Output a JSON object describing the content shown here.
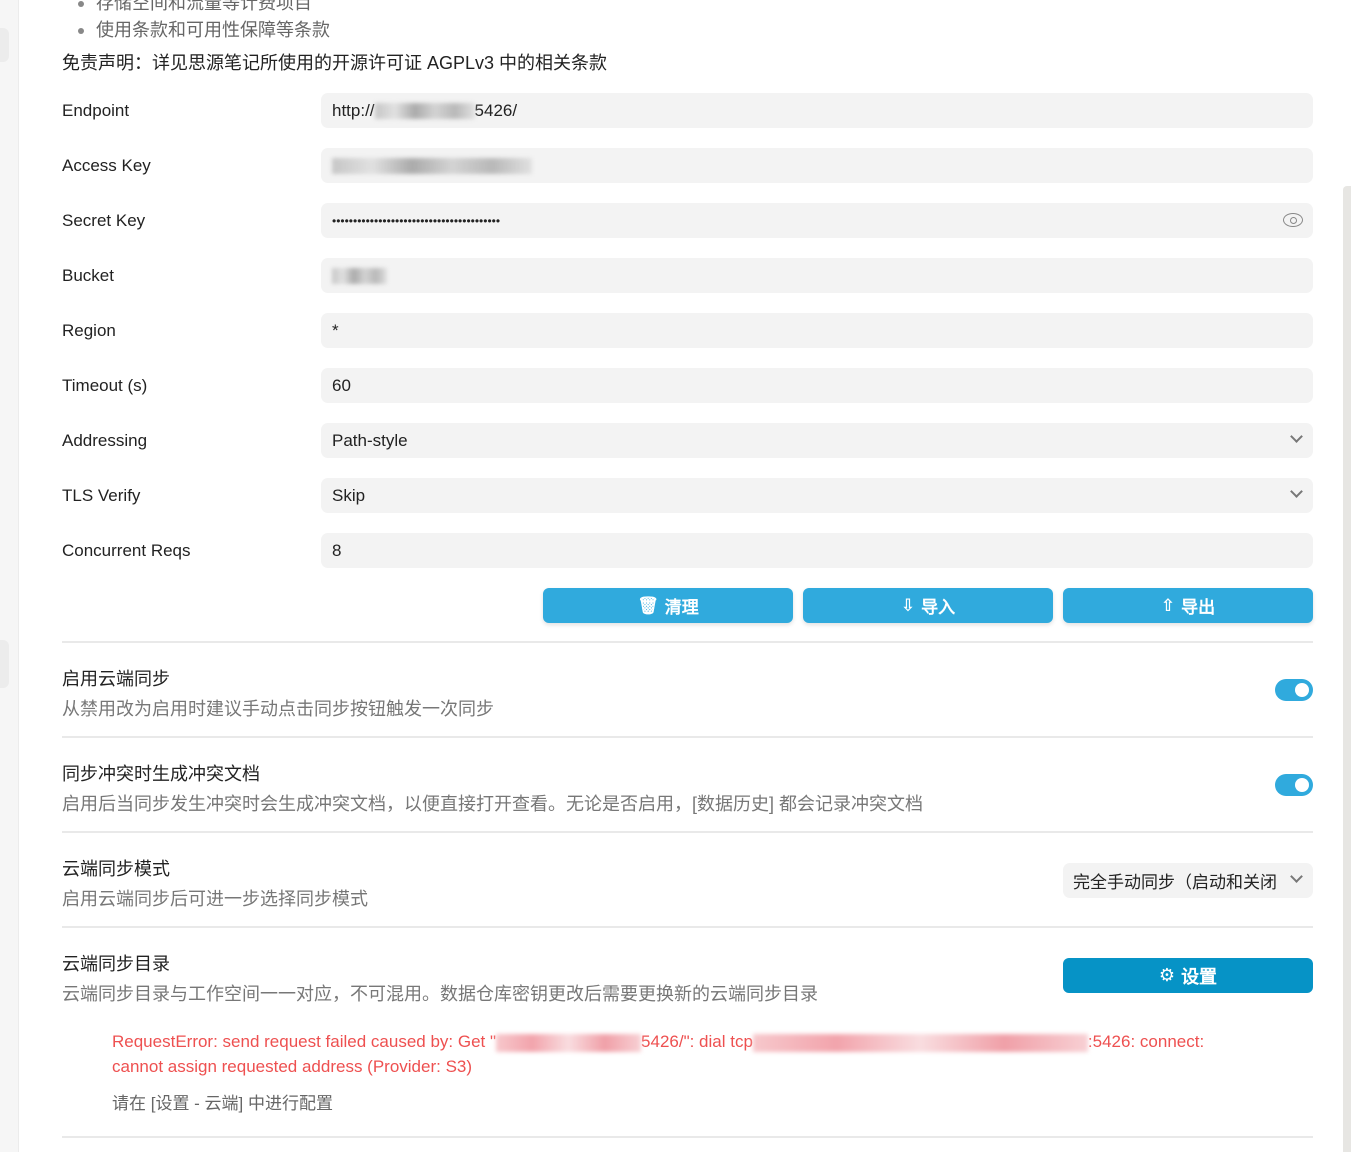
{
  "intro": {
    "bullets": [
      "存储空间和流量等计费项目",
      "使用条款和可用性保障等条款"
    ],
    "disclaimer": "免责声明：详见思源笔记所使用的开源许可证 AGPLv3 中的相关条款"
  },
  "form": {
    "endpoint": {
      "label": "Endpoint",
      "prefix": "http://",
      "suffix": "5426/"
    },
    "access_key": {
      "label": "Access Key"
    },
    "secret_key": {
      "label": "Secret Key",
      "value": "••••••••••••••••••••••••••••••••••••••••"
    },
    "bucket": {
      "label": "Bucket"
    },
    "region": {
      "label": "Region",
      "value": "*"
    },
    "timeout": {
      "label": "Timeout (s)",
      "value": "60"
    },
    "addressing": {
      "label": "Addressing",
      "value": "Path-style"
    },
    "tls_verify": {
      "label": "TLS Verify",
      "value": "Skip"
    },
    "concurrent": {
      "label": "Concurrent Reqs",
      "value": "8"
    }
  },
  "actions": {
    "purge": "清理",
    "import": "导入",
    "export": "导出"
  },
  "settings": [
    {
      "title": "启用云端同步",
      "desc": "从禁用改为启用时建议手动点击同步按钮触发一次同步",
      "enabled": true
    },
    {
      "title": "同步冲突时生成冲突文档",
      "desc": "启用后当同步发生冲突时会生成冲突文档，以便直接打开查看。无论是否启用，[数据历史] 都会记录冲突文档",
      "enabled": true
    },
    {
      "title": "云端同步模式",
      "desc": "启用云端同步后可进一步选择同步模式",
      "value": "完全手动同步（启动和关闭"
    },
    {
      "title": "云端同步目录",
      "desc": "云端同步目录与工作空间一一对应，不可混用。数据仓库密钥更改后需要更换新的云端同步目录",
      "button": "设置"
    }
  ],
  "error": {
    "part1": "RequestError: send request failed caused by: Get \"",
    "part2": "5426/\": dial tcp",
    "part3": ":5426: connect: cannot assign requested address (Provider: S3)",
    "hint": "请在 [设置 - 云端] 中进行配置"
  },
  "colors": {
    "accent": "#30aadd",
    "primary_button": "#0693c6",
    "error": "#ee5050"
  }
}
